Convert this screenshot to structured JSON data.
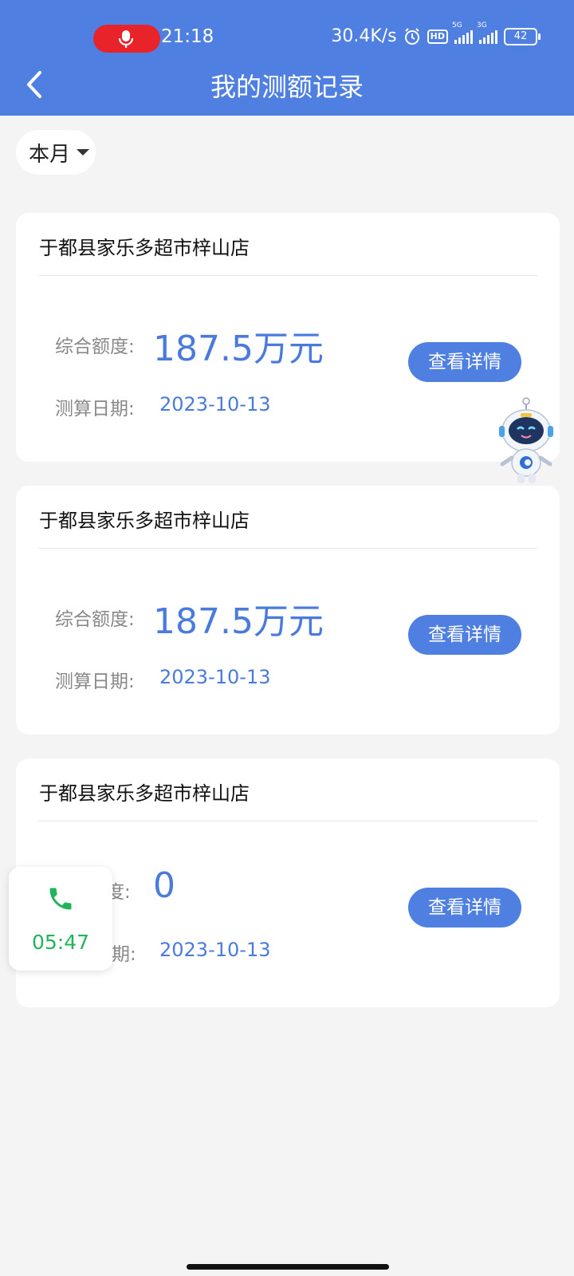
{
  "status_bar": {
    "time": "21:18",
    "net_speed": "30.4K/s",
    "hd_label": "HD",
    "signal1_label": "5G",
    "signal2_label": "3G",
    "battery": "42",
    "icons": [
      "mic-icon",
      "alarm-icon",
      "hd-icon",
      "signal-5g-icon",
      "signal-3g-icon",
      "battery-icon"
    ]
  },
  "header": {
    "title": "我的测额记录",
    "back_icon": "chevron-left-icon"
  },
  "filter": {
    "label": "本月"
  },
  "cards": [
    {
      "title": "于都县家乐多超市梓山店",
      "amount_label": "综合额度:",
      "amount": "187.5万元",
      "date_label": "测算日期:",
      "date": "2023-10-13",
      "button": "查看详情"
    },
    {
      "title": "于都县家乐多超市梓山店",
      "amount_label": "综合额度:",
      "amount": "187.5万元",
      "date_label": "测算日期:",
      "date": "2023-10-13",
      "button": "查看详情"
    },
    {
      "title": "于都县家乐多超市梓山店",
      "amount_label": "度:",
      "amount": "0",
      "date_label": "期:",
      "date": "2023-10-13",
      "button": "查看详情"
    }
  ],
  "call_widget": {
    "duration": "05:47",
    "icon": "phone-icon"
  },
  "colors": {
    "primary": "#4f7fe0",
    "value": "#4a7bdc",
    "call_green": "#22b45a",
    "record_red": "#e8232a"
  }
}
